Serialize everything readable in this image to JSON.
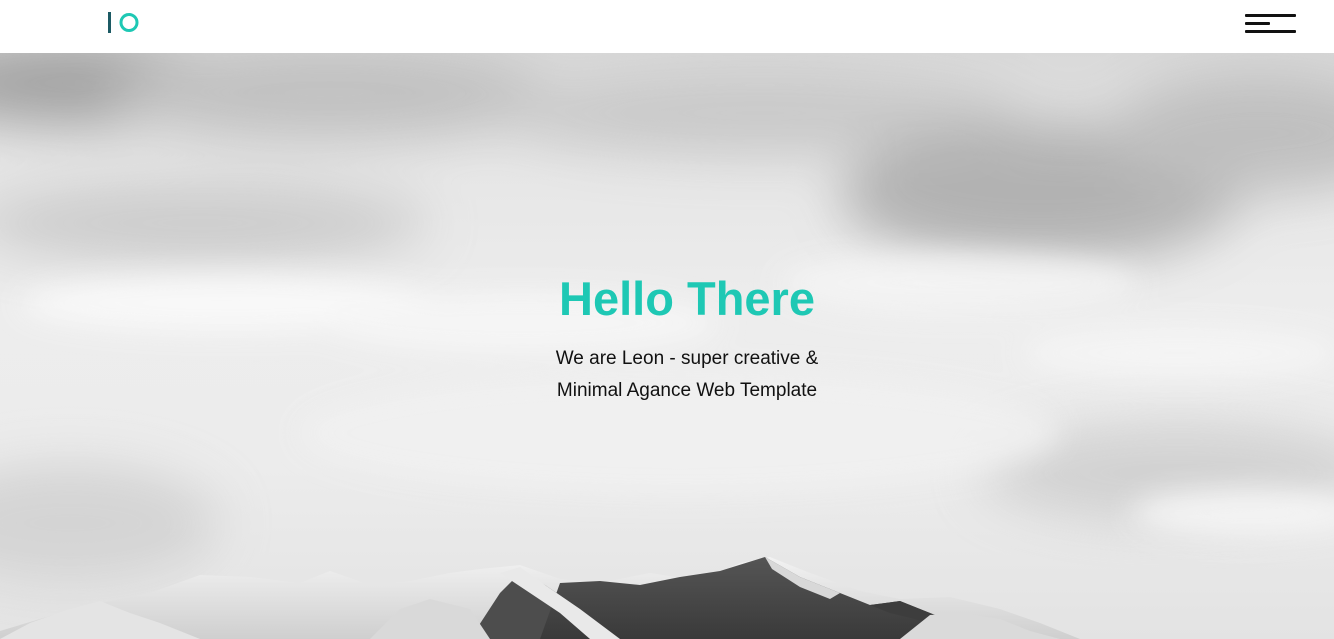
{
  "header": {
    "logo": {
      "icon": "io-logo-icon",
      "colors": {
        "bar": "#1c5a64",
        "ring": "#1ec8b4"
      }
    },
    "menu": {
      "icon": "hamburger-menu-icon"
    }
  },
  "hero": {
    "title": "Hello There",
    "subtitle_line1": "We are Leon - super creative &",
    "subtitle_line2": "Minimal Agance Web Template",
    "background": "mountain-clouds-image"
  },
  "colors": {
    "accent": "#1ec8b4",
    "text": "#111111",
    "header_bg": "#ffffff"
  }
}
